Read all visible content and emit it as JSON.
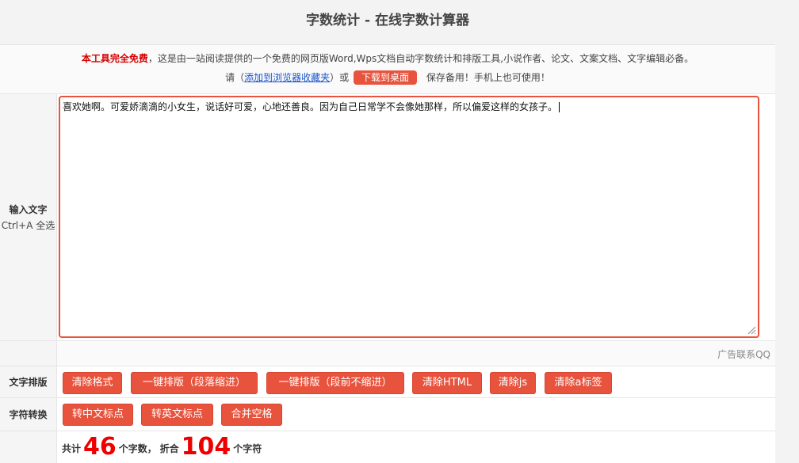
{
  "page": {
    "title": "字数统计 - 在线字数计算器"
  },
  "notice": {
    "highlight": "本工具完全免费",
    "line1_rest": "，这是由一站阅读提供的一个免费的网页版Word,Wps文档自动字数统计和排版工具,小说作者、论文、文案文档、文字编辑必备。",
    "line2_prefix": "请（",
    "bookmark_link": "添加到浏览器收藏夹",
    "line2_mid": "）或",
    "download_button": "下载到桌面",
    "line2_suffix": "保存备用！手机上也可使用！"
  },
  "input": {
    "label_main": "输入文字",
    "label_sub": "Ctrl+A 全选",
    "text": "喜欢她啊。可爱娇滴滴的小女生，说话好可爱，心地还善良。因为自己日常学不会像她那样，所以偏爱这样的女孩子。"
  },
  "ad": {
    "text": "广告联系QQ"
  },
  "format_row": {
    "label": "文字排版",
    "buttons": [
      "清除格式",
      "一键排版（段落缩进）",
      "一键排版（段前不缩进）",
      "清除HTML",
      "清除js",
      "清除a标签"
    ]
  },
  "convert_row": {
    "label": "字符转换",
    "buttons": [
      "转中文标点",
      "转英文标点",
      "合并空格"
    ]
  },
  "count": {
    "prefix": "共计",
    "words": "46",
    "words_unit": "个字数，",
    "mid": "折合",
    "chars": "104",
    "chars_unit": "个字符"
  },
  "colors": {
    "accent": "#e8533d",
    "count_red": "#e00000",
    "link": "#1a55c8"
  }
}
